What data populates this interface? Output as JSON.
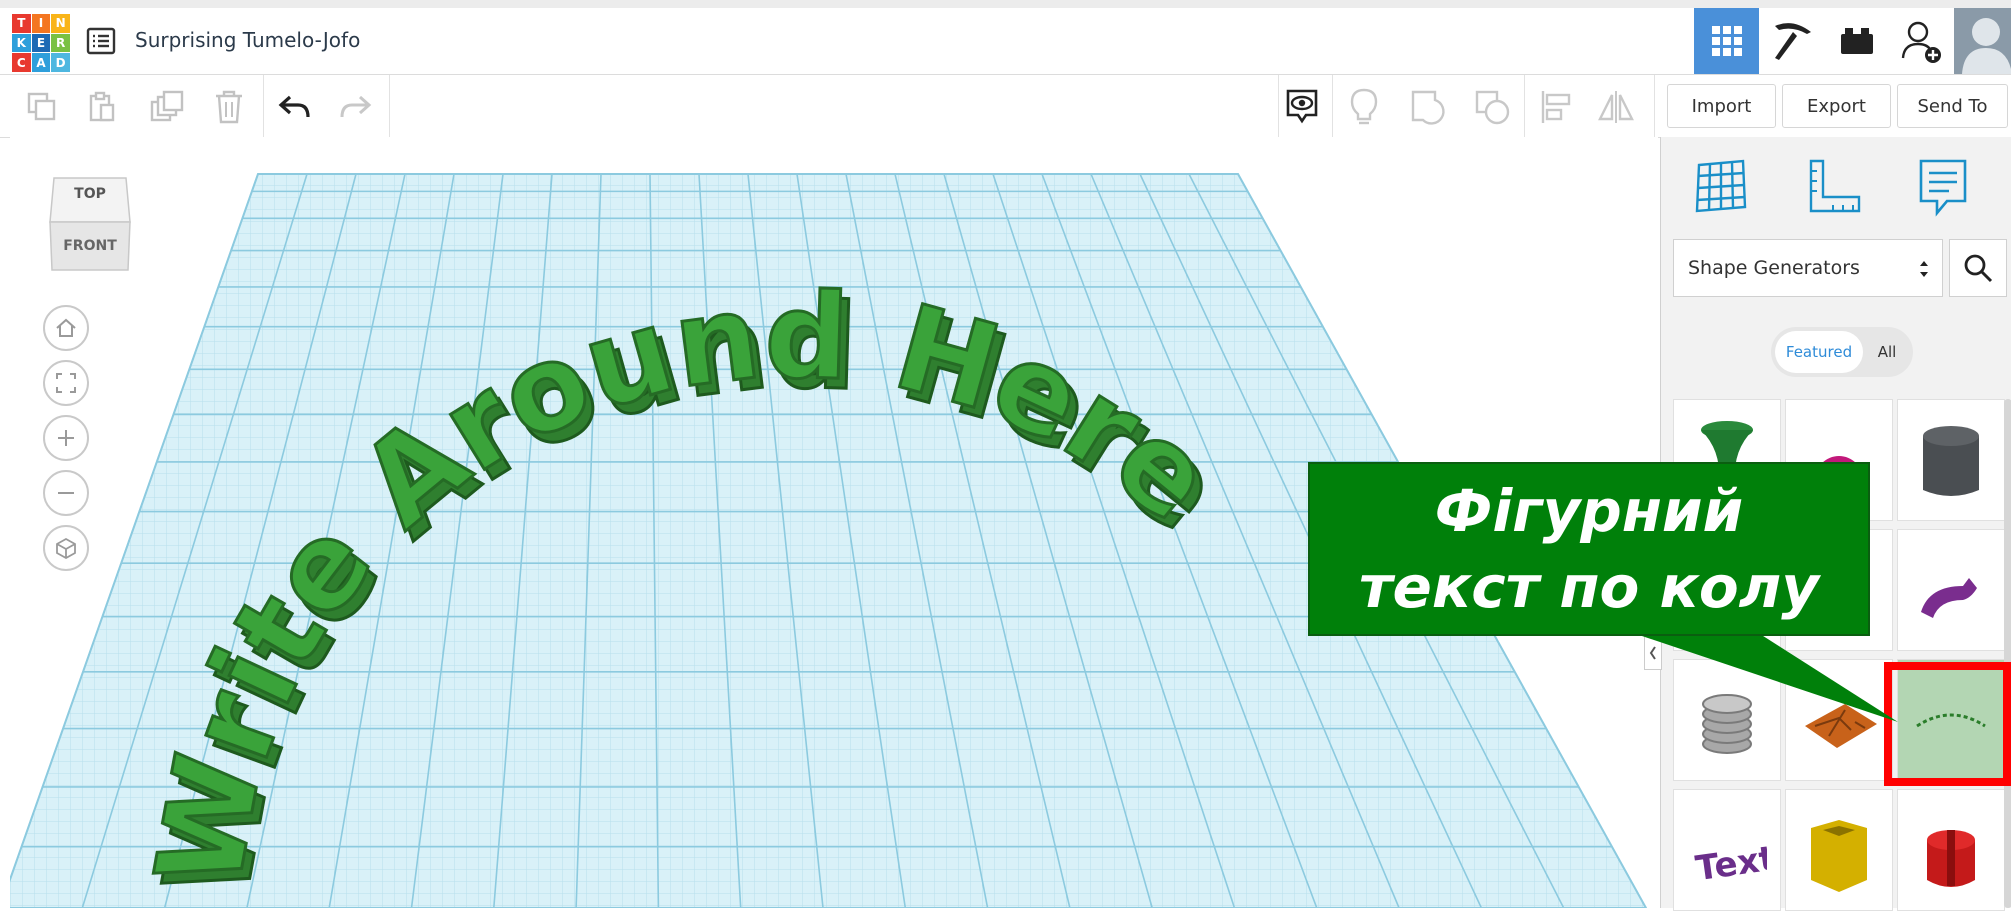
{
  "app": {
    "logo_letters": [
      "T",
      "I",
      "N",
      "K",
      "E",
      "R",
      "C",
      "A",
      "D"
    ],
    "logo_colors": [
      "#e8392f",
      "#f47621",
      "#f9b418",
      "#2e9fdb",
      "#1d6ab5",
      "#7ac143",
      "#e8392f",
      "#2e9fdb",
      "#4eb7e0"
    ],
    "project_title": "Surprising Tumelo-Jofo",
    "accent_color": "#4a90d9"
  },
  "header": {
    "view_buttons": [
      "3d-design-view",
      "circuits-view",
      "blocks-view",
      "invite-user"
    ],
    "active_view": "3d-design-view"
  },
  "toolbar": {
    "import_label": "Import",
    "export_label": "Export",
    "send_to_label": "Send To"
  },
  "viewcube": {
    "top_label": "TOP",
    "front_label": "FRONT"
  },
  "scene": {
    "text_on_plane": "Write Around Here",
    "text_color": "#3aa33a",
    "grid_color": "#a3d6e6"
  },
  "panel": {
    "category_select": "Shape Generators",
    "tab_featured": "Featured",
    "tab_all": "All",
    "tiles": [
      "tiered-base",
      "pink-sphere",
      "dark-cylinder",
      "blank",
      "blank",
      "purple-tube",
      "threads",
      "brick-pattern",
      "text-around-circle",
      "text-shape",
      "yellow-square-tube",
      "red-clip"
    ]
  },
  "annotation": {
    "line1": "Фігурний",
    "line2": "текст по колу",
    "highlight_color": "#ff0000",
    "callout_color": "#00800a"
  }
}
